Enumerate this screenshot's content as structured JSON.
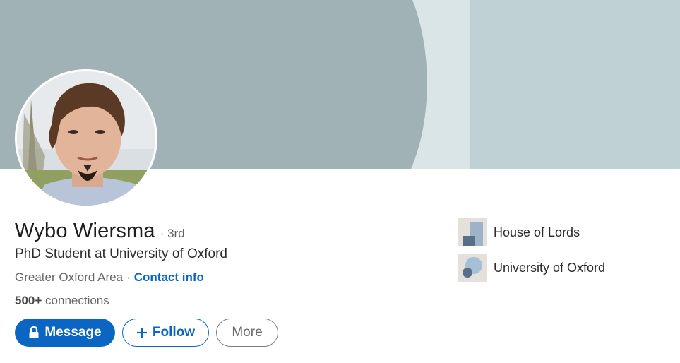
{
  "profile": {
    "name": "Wybo Wiersma",
    "degree": "· 3rd",
    "headline": "PhD Student at University of Oxford",
    "location": "Greater Oxford Area",
    "separator": "·",
    "contact_info": "Contact info",
    "connections_count": "500+",
    "connections_label": "connections"
  },
  "actions": {
    "message": "Message",
    "follow": "Follow",
    "more": "More"
  },
  "organizations": [
    {
      "name": "House of Lords",
      "icon": "company-logo-icon"
    },
    {
      "name": "University of Oxford",
      "icon": "school-logo-icon"
    }
  ],
  "colors": {
    "brand_blue": "#0a66c2",
    "cover_left": "#a0b2b6",
    "cover_right": "#bed2d5"
  }
}
